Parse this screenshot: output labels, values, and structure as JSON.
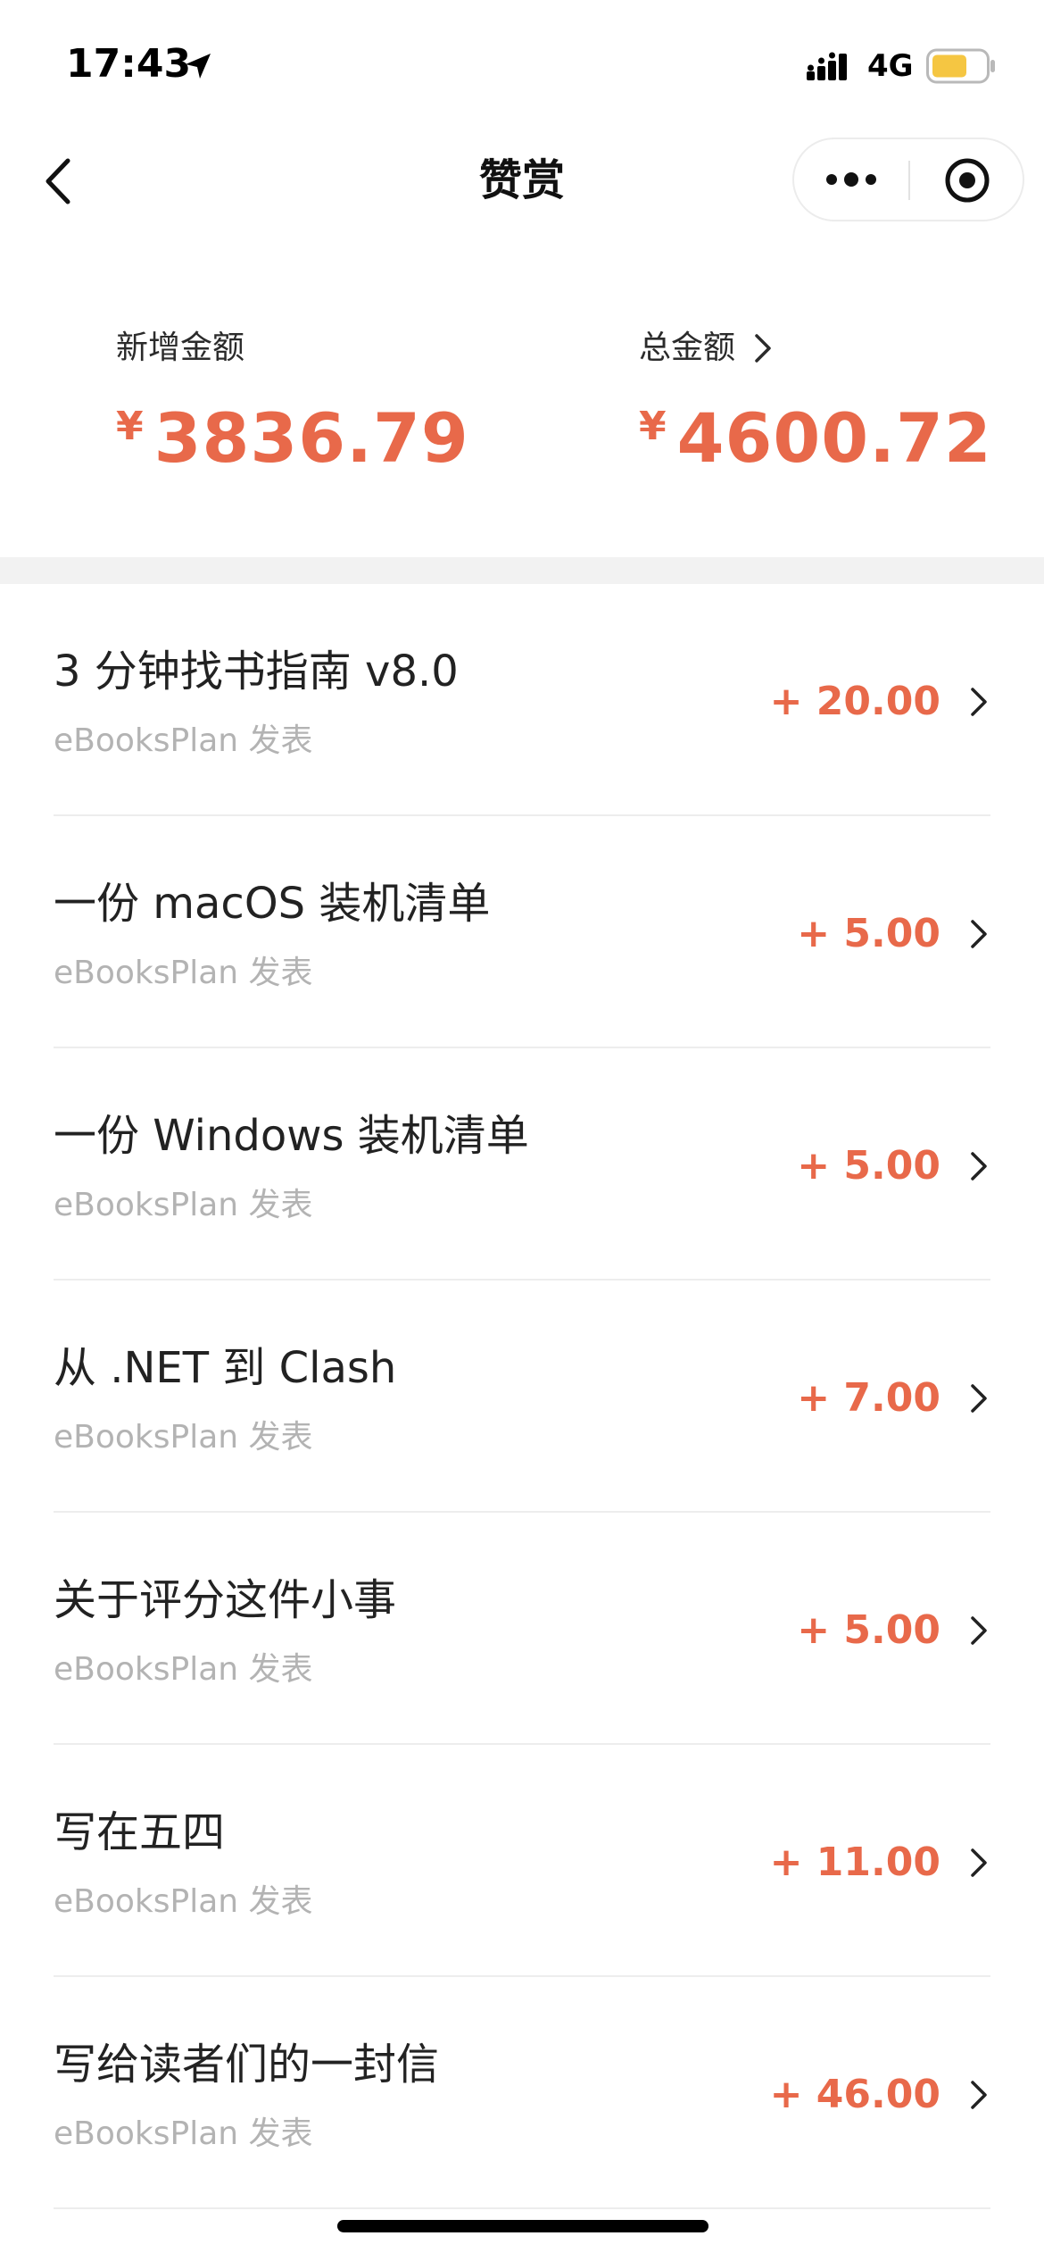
{
  "status_bar": {
    "time": "17:43",
    "network": "4G",
    "icons": [
      "location-arrow-icon",
      "signal-icon",
      "battery-icon"
    ],
    "battery_color": "#f5c642"
  },
  "nav": {
    "title": "赞赏",
    "back_icon": "chevron-left-icon",
    "more_icon": "more-dots-icon",
    "close_icon": "target-circle-icon"
  },
  "summary": {
    "new_label": "新增金额",
    "new_currency": "¥",
    "new_amount": "3836.79",
    "total_label": "总金额",
    "total_currency": "¥",
    "total_amount": "4600.72"
  },
  "colors": {
    "accent": "#e8694a",
    "subtitle": "#b3b3b3",
    "divider": "#ededed",
    "section_gap": "#f2f2f2"
  },
  "items": [
    {
      "title": "3 分钟找书指南 v8.0",
      "subtitle": "eBooksPlan 发表",
      "amount": "+ 20.00"
    },
    {
      "title": "一份 macOS 装机清单",
      "subtitle": "eBooksPlan 发表",
      "amount": "+ 5.00"
    },
    {
      "title": "一份 Windows 装机清单",
      "subtitle": "eBooksPlan 发表",
      "amount": "+ 5.00"
    },
    {
      "title": "从 .NET 到 Clash",
      "subtitle": "eBooksPlan 发表",
      "amount": "+ 7.00"
    },
    {
      "title": "关于评分这件小事",
      "subtitle": "eBooksPlan 发表",
      "amount": "+ 5.00"
    },
    {
      "title": "写在五四",
      "subtitle": "eBooksPlan 发表",
      "amount": "+ 11.00"
    },
    {
      "title": "写给读者们的一封信",
      "subtitle": "eBooksPlan 发表",
      "amount": "+ 46.00"
    }
  ]
}
